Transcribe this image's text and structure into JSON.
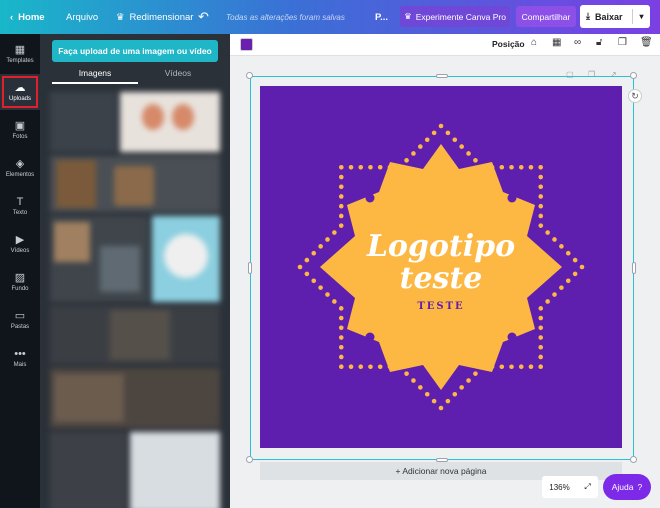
{
  "topbar": {
    "home_label": "Home",
    "file_label": "Arquivo",
    "resize_label": "Redimensionar",
    "saved_status": "Todas as alterações foram salvas",
    "truncated_label": "P...",
    "pro_label": "Experimente Canva Pro",
    "share_label": "Compartilhar",
    "download_label": "Baixar"
  },
  "rail": {
    "items": [
      {
        "label": "Templates",
        "icon": "templates-icon"
      },
      {
        "label": "Uploads",
        "icon": "upload-cloud-icon"
      },
      {
        "label": "Fotos",
        "icon": "photo-icon"
      },
      {
        "label": "Elementos",
        "icon": "shapes-icon"
      },
      {
        "label": "Texto",
        "icon": "text-icon"
      },
      {
        "label": "Vídeos",
        "icon": "video-icon"
      },
      {
        "label": "Fundo",
        "icon": "background-icon"
      },
      {
        "label": "Pastas",
        "icon": "folder-icon"
      },
      {
        "label": "Mais",
        "icon": "more-icon"
      }
    ],
    "active": "Uploads"
  },
  "panel": {
    "upload_button": "Faça upload de uma imagem ou vídeo",
    "tabs": [
      "Imagens",
      "Vídeos"
    ],
    "active_tab": "Imagens"
  },
  "editor": {
    "position_label": "Posição",
    "add_page_label": "+ Adicionar nova página",
    "selected_color": "#6a1fb0"
  },
  "design": {
    "background_color": "#5f1fae",
    "badge_color": "#fdb843",
    "title_line1": "Logotipo",
    "title_line2": "teste",
    "subtitle": "TESTE"
  },
  "footer": {
    "zoom": "136%",
    "help_label": "Ajuda",
    "help_symbol": "?"
  },
  "colors": {
    "accent_teal": "#1fb6c8",
    "accent_purple": "#7d2ae8",
    "sidebar_dark": "#10151c",
    "panel_dark": "#2b3139"
  }
}
